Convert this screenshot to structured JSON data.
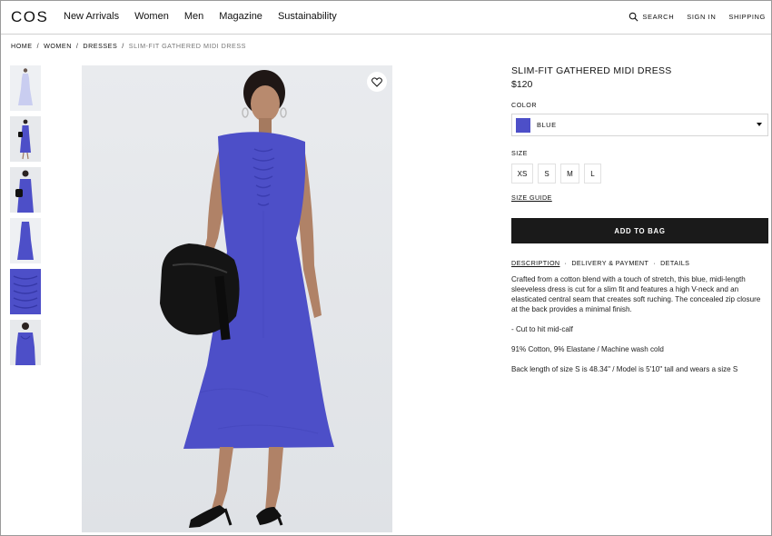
{
  "header": {
    "logo": "COS",
    "nav": [
      "New Arrivals",
      "Women",
      "Men",
      "Magazine",
      "Sustainability"
    ],
    "search_label": "SEARCH",
    "sign_in_label": "SIGN IN",
    "shipping_label": "SHIPPING"
  },
  "breadcrumb": [
    "HOME",
    "WOMEN",
    "DRESSES",
    "SLIM-FIT GATHERED MIDI DRESS"
  ],
  "breadcrumb_separator": "/",
  "product": {
    "title": "SLIM-FIT GATHERED MIDI DRESS",
    "price": "$120",
    "color_label": "COLOR",
    "selected_color": "BLUE",
    "color_hex": "#4d4fc8",
    "size_label": "SIZE",
    "sizes": [
      "XS",
      "S",
      "M",
      "L"
    ],
    "size_guide": "SIZE GUIDE",
    "add_to_bag": "ADD TO BAG",
    "tabs": [
      "DESCRIPTION",
      "DELIVERY & PAYMENT",
      "DETAILS"
    ],
    "tab_separator": "·",
    "description": [
      "Crafted from a cotton blend with a touch of stretch, this blue, midi-length sleeveless dress is cut for a slim fit and features a high V-neck and an elasticated central seam that creates soft ruching. The concealed zip closure at the back provides a minimal finish.",
      "- Cut to hit mid-calf",
      "91% Cotton, 9% Elastane / Machine wash cold",
      "Back length of size S is 48.34\" / Model is 5'10\" tall and wears a size S"
    ]
  },
  "colors": {
    "dress": "#4d4fc8",
    "button_bg": "#1a1a1a",
    "image_bg": "#e6e8eb"
  },
  "icons": {
    "search": "search-icon",
    "wishlist": "heart-icon",
    "dropdown": "chevron-down-icon"
  }
}
